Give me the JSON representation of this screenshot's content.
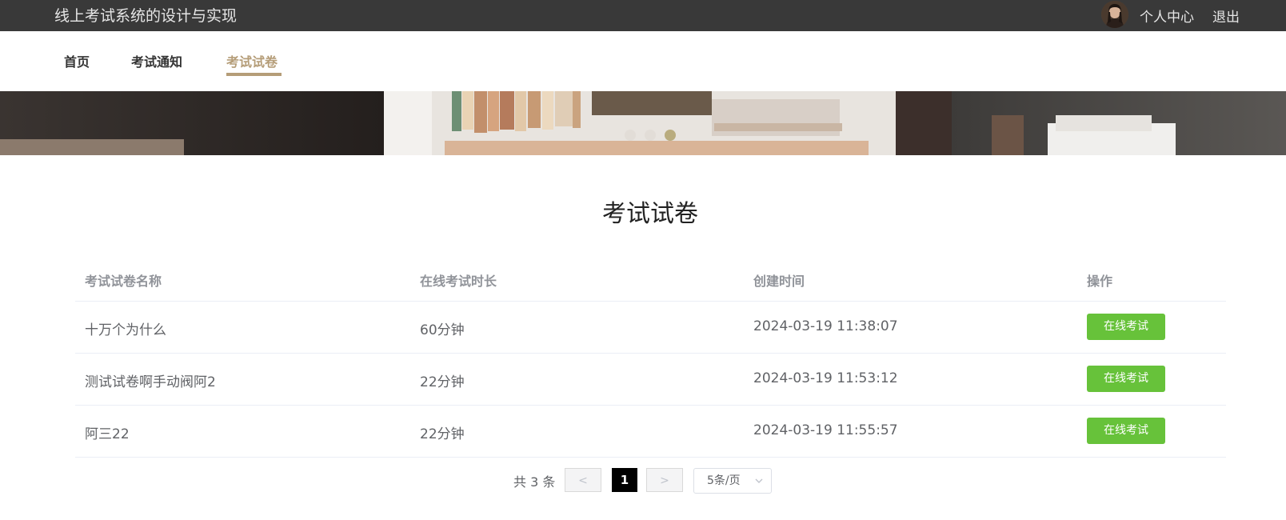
{
  "header": {
    "app_title": "线上考试系统的设计与实现",
    "personal_center": "个人中心",
    "logout": "退出"
  },
  "nav": {
    "items": [
      {
        "label": "首页",
        "active": false
      },
      {
        "label": "考试通知",
        "active": false
      },
      {
        "label": "考试试卷",
        "active": true
      }
    ]
  },
  "banner": {
    "slide_count": 3,
    "active_slide": 3
  },
  "main": {
    "title": "考试试卷"
  },
  "table": {
    "columns": [
      "考试试卷名称",
      "在线考试时长",
      "创建时间",
      "操作"
    ],
    "rows": [
      {
        "name": "十万个为什么",
        "duration": "60分钟",
        "created": "2024-03-19 11:38:07",
        "action": "在线考试"
      },
      {
        "name": "测试试卷啊手动阀阿2",
        "duration": "22分钟",
        "created": "2024-03-19 11:53:12",
        "action": "在线考试"
      },
      {
        "name": "阿三22",
        "duration": "22分钟",
        "created": "2024-03-19 11:55:57",
        "action": "在线考试"
      }
    ]
  },
  "pagination": {
    "total_text": "共 3 条",
    "prev": "<",
    "current_page": "1",
    "next": ">",
    "page_size": "5条/页"
  },
  "colors": {
    "topbar": "#393939",
    "accent": "#b59d78",
    "action_button": "#67c23a"
  }
}
